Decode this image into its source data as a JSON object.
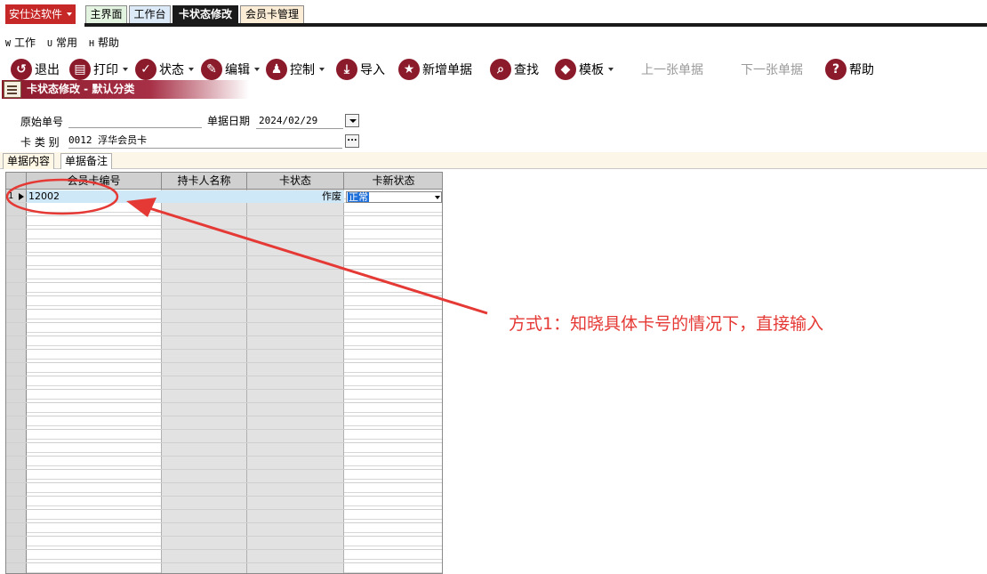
{
  "app": {
    "brand": "安仕达软件"
  },
  "tabs": [
    {
      "label": "主界面"
    },
    {
      "label": "工作台"
    },
    {
      "label": "卡状态修改"
    },
    {
      "label": "会员卡管理"
    }
  ],
  "menu": [
    {
      "key": "W",
      "label": "工作"
    },
    {
      "key": "U",
      "label": "常用"
    },
    {
      "key": "H",
      "label": "帮助"
    }
  ],
  "toolbar": {
    "exit": "退出",
    "print": "打印",
    "status": "状态",
    "edit": "编辑",
    "control": "控制",
    "import": "导入",
    "new_doc": "新增单据",
    "find": "查找",
    "template": "模板",
    "prev_doc": "上一张单据",
    "next_doc": "下一张单据",
    "help": "帮助"
  },
  "title": "卡状态修改 - 默认分类",
  "form": {
    "orig_no_label": "原始单号",
    "orig_no_value": "",
    "date_label": "单据日期",
    "date_value": "2024/02/29",
    "card_type_label": "卡 类 别",
    "card_type_value": "0012 浮华会员卡"
  },
  "subtabs": [
    {
      "label": "单据内容"
    },
    {
      "label": "单据备注"
    }
  ],
  "grid": {
    "headers": [
      "会员卡编号",
      "持卡人名称",
      "卡状态",
      "卡新状态"
    ],
    "rows": [
      {
        "num": "1",
        "card_no": "12002",
        "holder": "",
        "status": "作废",
        "new_status": "正常"
      }
    ]
  },
  "annotation": {
    "text": "方式1：知晓具体卡号的情况下，直接输入",
    "color": "#e53935"
  }
}
